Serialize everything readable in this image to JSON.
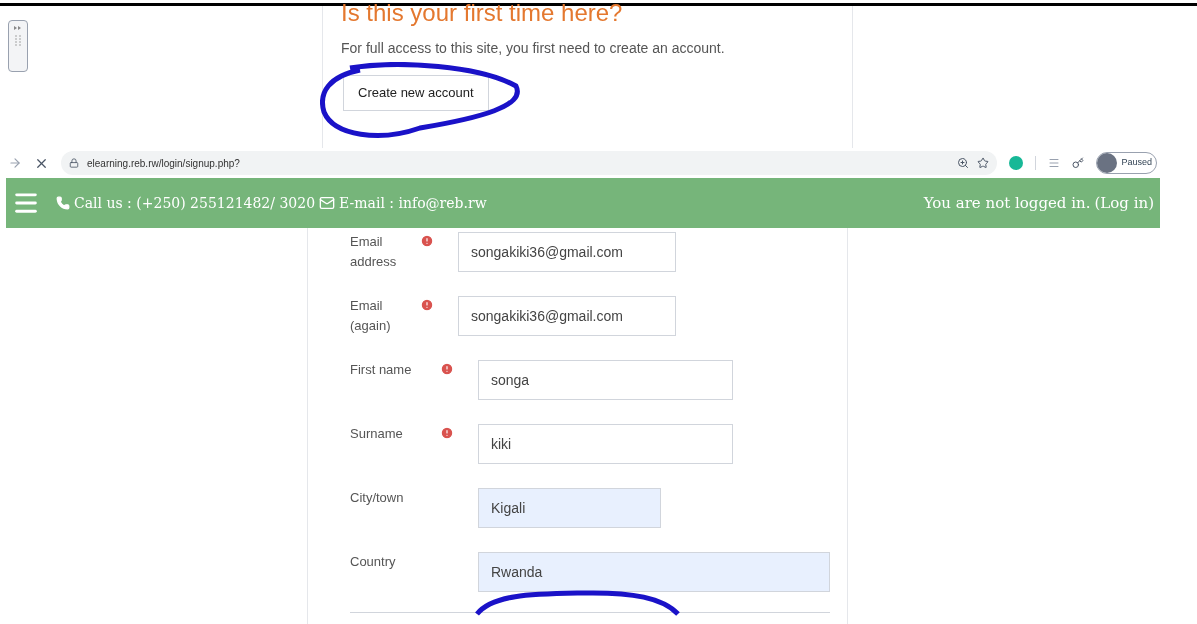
{
  "intro": {
    "heading": "Is this your first time here?",
    "text": "For full access to this site, you first need to create an account.",
    "button": "Create new account"
  },
  "browser": {
    "url": "elearning.reb.rw/login/signup.php?",
    "profile_status": "Paused"
  },
  "site_header": {
    "contact": "Call us : (+250) 255121482/ 3020",
    "email": "E-mail : info@reb.rw",
    "login_text": "You are not logged in.",
    "login_link": "(Log in)"
  },
  "form": {
    "fields": [
      {
        "label": "Email address",
        "required": true,
        "value": "songakiki36@gmail.com",
        "autofilled": false
      },
      {
        "label": "Email (again)",
        "required": true,
        "value": "songakiki36@gmail.com",
        "autofilled": false
      },
      {
        "label": "First name",
        "required": true,
        "value": "songa",
        "autofilled": false
      },
      {
        "label": "Surname",
        "required": true,
        "value": "kiki",
        "autofilled": false
      },
      {
        "label": "City/town",
        "required": false,
        "value": "Kigali",
        "autofilled": true
      },
      {
        "label": "Country",
        "required": false,
        "value": "Rwanda",
        "autofilled": true
      }
    ]
  }
}
